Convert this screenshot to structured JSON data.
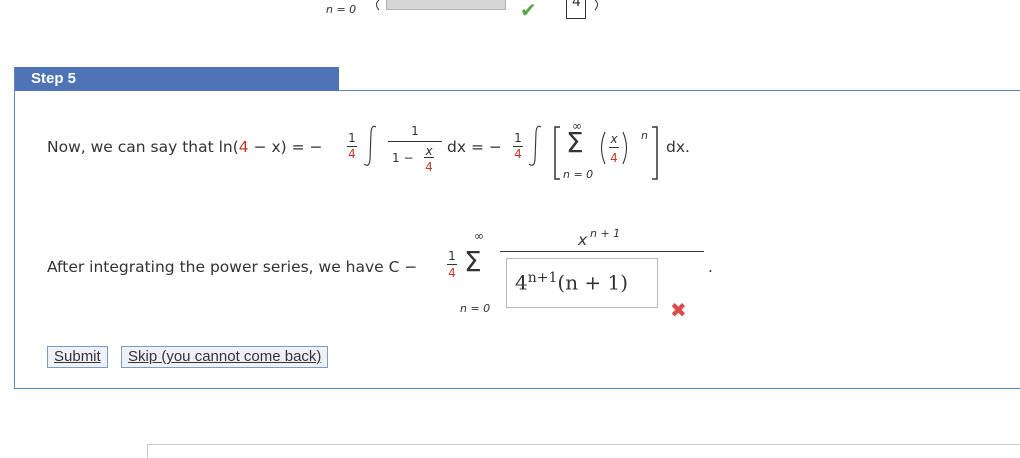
{
  "top_fragment": {
    "sum_lower": "n = 0",
    "term_num": "4"
  },
  "step": {
    "title": "Step 5"
  },
  "line1": {
    "prefix": "Now, we can say that ln(",
    "four": "4",
    "minus_x": " − x) = −",
    "frac_num": "1",
    "frac_den": "4",
    "inner_num": "1",
    "inner_den_one": "1 −",
    "inner_x": "x",
    "inner_four": "4",
    "dx1": "dx = −",
    "frac2_num": "1",
    "frac2_den": "4",
    "inf": "∞",
    "sigma": "Σ",
    "lower": "n = 0",
    "x": "x",
    "four2": "4",
    "exp": "n",
    "dx2": "dx."
  },
  "line2": {
    "prefix": "After integrating the power series, we have C −",
    "frac_num": "1",
    "frac_den": "4",
    "inf": "∞",
    "sigma": "Σ",
    "lower": "n = 0",
    "numerator": "x",
    "num_exp": "n + 1",
    "period": "."
  },
  "answer": {
    "base": "4",
    "exp": "n+1",
    "tail": "(n + 1)"
  },
  "status": {
    "wrong": "✖",
    "correct": "✔"
  },
  "buttons": {
    "submit": "Submit",
    "skip": "Skip (you cannot come back)"
  }
}
